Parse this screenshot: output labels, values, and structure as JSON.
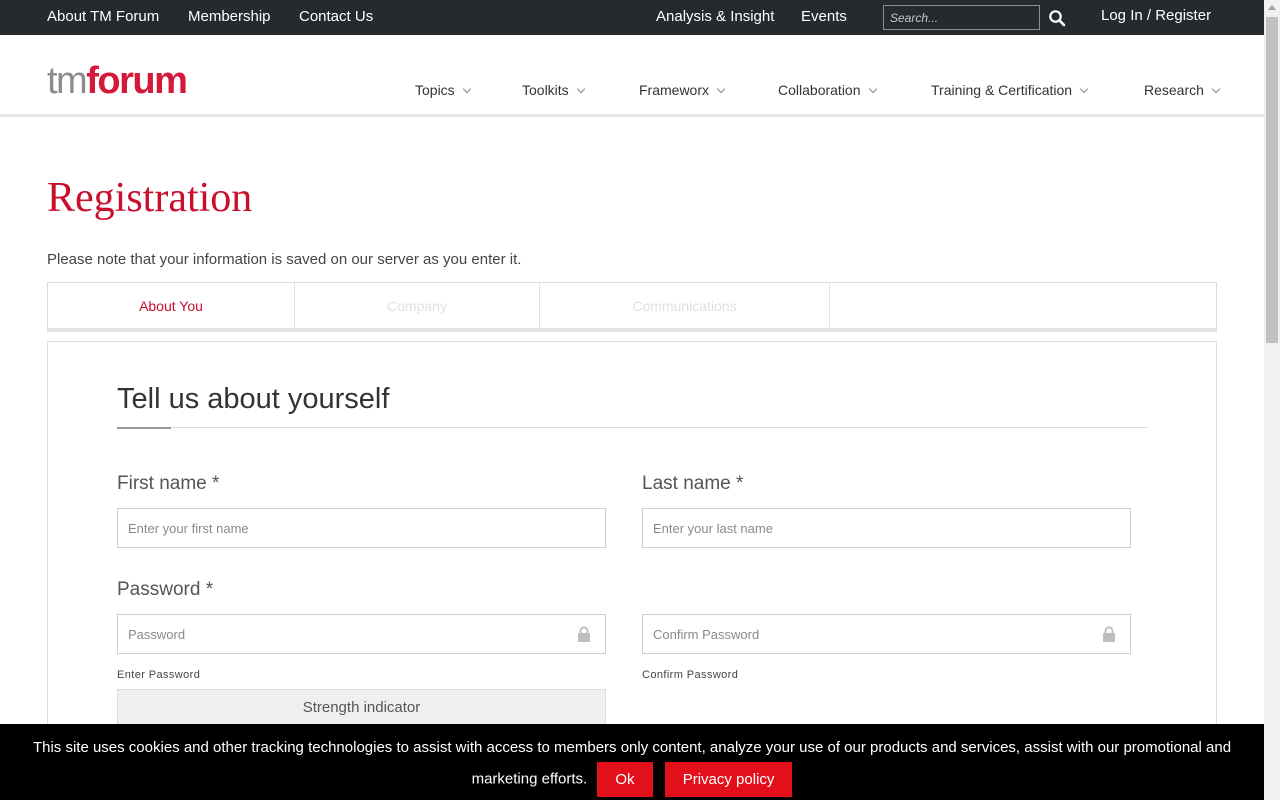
{
  "topbar": {
    "about": "About TM Forum",
    "membership": "Membership",
    "contact": "Contact Us",
    "analysis": "Analysis & Insight",
    "events": "Events",
    "search_placeholder": "Search...",
    "login": "Log In / Register"
  },
  "header": {
    "logo_tm": "tm",
    "logo_forum": "forum",
    "nav": [
      "Topics",
      "Toolkits",
      "Frameworx",
      "Collaboration",
      "Training & Certification",
      "Research"
    ]
  },
  "page": {
    "title": "Registration",
    "note": "Please note that your information is saved on our server as you enter it."
  },
  "tabs": [
    "About You",
    "Company",
    "Communications"
  ],
  "form": {
    "section_title": "Tell us about yourself",
    "first_name_label": "First name *",
    "first_name_placeholder": "Enter your first name",
    "last_name_label": "Last name *",
    "last_name_placeholder": "Enter your last name",
    "password_label": "Password *",
    "password_placeholder": "Password",
    "confirm_placeholder": "Confirm Password",
    "password_hint": "Enter Password",
    "confirm_hint": "Confirm Password",
    "strength": "Strength indicator"
  },
  "cookie": {
    "text": "This site uses cookies and other tracking technologies to assist with access to members only content, analyze your use of our products and services, assist with our promotional and marketing efforts.",
    "ok": "Ok",
    "privacy": "Privacy policy"
  },
  "colors": {
    "brand_red": "#c8102e",
    "topbar_bg": "#26292e",
    "button_red": "#e3101c"
  },
  "icons": [
    "search-icon",
    "chevron-down-icon",
    "lock-icon"
  ]
}
